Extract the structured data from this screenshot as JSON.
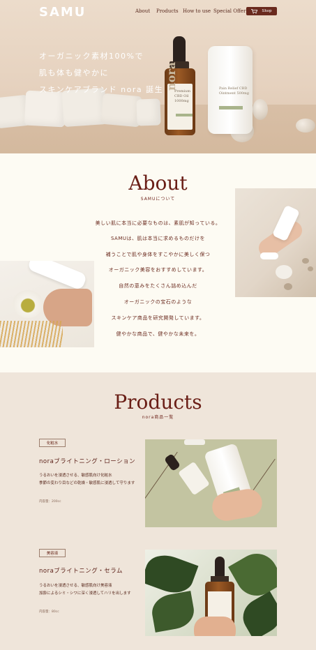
{
  "header": {
    "logo": "SAMU",
    "nav": [
      "About",
      "Products",
      "How to use",
      "Special Offer"
    ],
    "shop_label": "Shop"
  },
  "hero": {
    "lines": [
      "オーガニック素材100%で",
      "肌も体も健やかに",
      "スキンケアブランド nora 誕生"
    ],
    "bottle": {
      "brand": "nora",
      "label": "Premium CBD Oil 1000mg"
    },
    "jar": {
      "label": "Pain Relief CBD Ointment 500mg"
    }
  },
  "about": {
    "title": "About",
    "subtitle": "SAMUについて",
    "lines": [
      "美しい肌に本当に必要なものは、素肌が知っている。",
      "SAMUは、肌は本当に求めるものだけを",
      "補うことで肌や身体をすこやかに美しく保つ",
      "オーガニック美容をおすすめしています。",
      "自然の恵みをたくさん詰め込んだ",
      "オーガニックの宝石のような",
      "スキンケア商品を研究開発しています。",
      "健やかな商品で、健やかな未来を。"
    ]
  },
  "products": {
    "title": "Products",
    "subtitle": "nora商品一覧",
    "items": [
      {
        "tag": "化粧水",
        "name": "noraブライトニング・ローション",
        "desc": [
          "うるおいを浸透させる、敏感肌向け化粧水",
          "季節の変わり目などの乾燥・敏感肌に浸透して守ります"
        ],
        "volume": "内容量：200cc"
      },
      {
        "tag": "美容液",
        "name": "noraブライトニング・セラム",
        "desc": [
          "うるおいを浸透させる、敏感肌向け美容液",
          "加齢によるシミ・シワに深く浸透してハリを出します"
        ],
        "volume": "内容量：80cc"
      }
    ]
  },
  "colors": {
    "accent": "#6a2a1e",
    "hero_bg": "#e6d2bf",
    "about_bg": "#fdfbf3",
    "products_bg": "#efe5da"
  }
}
